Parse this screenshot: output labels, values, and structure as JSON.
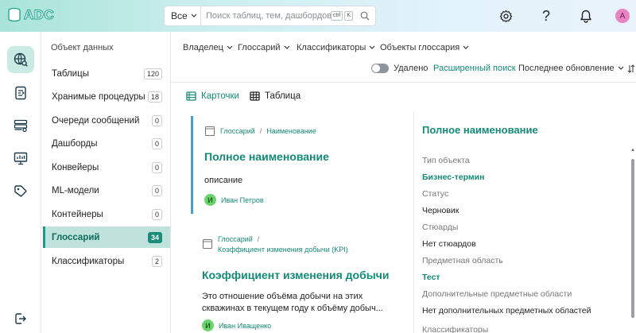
{
  "header": {
    "logo_text": "ADC",
    "search_scope": "Все",
    "search_placeholder": "Поиск таблиц, тем, дашбордов, ...",
    "kbd_ctrl": "ctrl",
    "kbd_k": "K",
    "avatar_letter": "A"
  },
  "rail": {
    "items": [
      "globe-search",
      "procedures",
      "queues",
      "dashboards",
      "tags"
    ],
    "logout": "logout"
  },
  "sidebar": {
    "title": "Объект данных",
    "items": [
      {
        "label": "Таблицы",
        "count": "120"
      },
      {
        "label": "Хранимые процедуры",
        "count": "18"
      },
      {
        "label": "Очереди сообщений",
        "count": "0"
      },
      {
        "label": "Дашборды",
        "count": "0"
      },
      {
        "label": "Конвейеры",
        "count": "0"
      },
      {
        "label": "ML-модели",
        "count": "0"
      },
      {
        "label": "Контейнеры",
        "count": "0"
      },
      {
        "label": "Глоссарий",
        "count": "34"
      },
      {
        "label": "Классификаторы",
        "count": "2"
      }
    ]
  },
  "filters": {
    "owner": "Владелец",
    "glossary": "Глоссарий",
    "classifiers": "Классификаторы",
    "glossary_objects": "Объекты глоссария",
    "deleted": "Удалено",
    "advanced_search": "Расширенный поиск",
    "sort": "Последнее обновление"
  },
  "views": {
    "cards": "Карточки",
    "table": "Таблица"
  },
  "cards": [
    {
      "path1": "Глоссарий",
      "sep": "/",
      "path2": "Наименование",
      "title": "Полное наименование",
      "desc": "описание",
      "owner_initial": "И",
      "owner": "Иван Петров"
    },
    {
      "path1": "Глоссарий",
      "sep": "/",
      "path2": "Коэффициент изменения добычи (KPI)",
      "title": "Коэффициент изменения добычи",
      "desc1": "Это отношение объёма добычи на этих",
      "desc2": "скважинах в текущем году к объёму добыч...",
      "owner_initial": "И",
      "owner": "Иван Иващенко"
    }
  ],
  "detail": {
    "title": "Полное наименование",
    "rows": [
      {
        "label": "Тип объекта",
        "value": "Бизнес-термин"
      },
      {
        "label": "Статус",
        "value": "Черновик"
      },
      {
        "label": "Стюарды",
        "value": "Нет стюардов"
      },
      {
        "label": "Предметная область",
        "value": "Тест"
      },
      {
        "label": "Дополнительные предметные области",
        "value": "Нет дополнительных предметных областей"
      },
      {
        "label": "Классификаторы",
        "value": ""
      }
    ]
  },
  "colors": {
    "accent": "#148a75",
    "active_bg": "#bfe3dc",
    "selected_border": "#3aa3d6"
  }
}
